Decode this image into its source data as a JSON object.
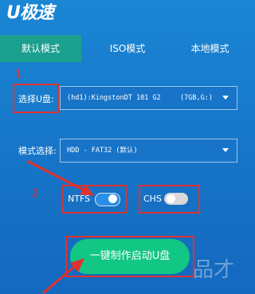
{
  "app": {
    "logo_text": "U极速"
  },
  "tabs": [
    {
      "label": "默认模式",
      "active": true
    },
    {
      "label": "ISO模式",
      "active": false
    },
    {
      "label": "本地模式",
      "active": false
    }
  ],
  "form": {
    "disk_label": "选择U盘:",
    "disk_value": "(hd1):KingstonDT 101 G2",
    "disk_size": "(7GB,G:)",
    "mode_label": "模式选择:",
    "mode_value": "HDD - FAT32 (默认)"
  },
  "toggles": [
    {
      "label": "NTFS",
      "on": true
    },
    {
      "label": "CHS",
      "on": false
    }
  ],
  "action": {
    "label": "一键制作启动U盘"
  },
  "annotations": {
    "step1": "1",
    "step2": "2"
  },
  "watermark": "品才",
  "colors": {
    "accent": "#12c683",
    "active_tab": "#1b9f8f",
    "highlight": "#e0322d",
    "toggle_on": "#2a8de6",
    "toggle_off": "#d9d9d9"
  }
}
